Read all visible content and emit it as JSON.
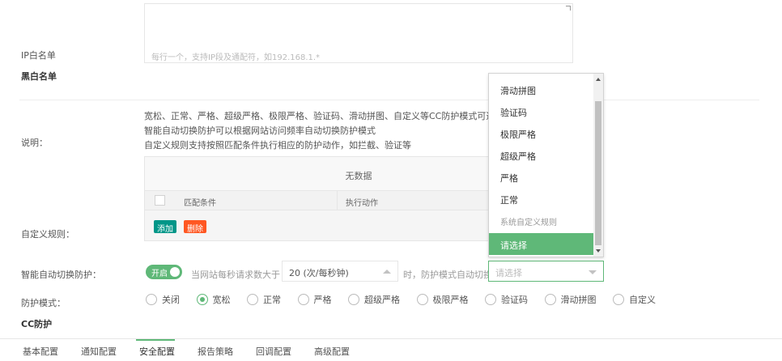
{
  "tabs": [
    {
      "label": "基本配置"
    },
    {
      "label": "通知配置"
    },
    {
      "label": "安全配置"
    },
    {
      "label": "报告策略"
    },
    {
      "label": "回调配置"
    },
    {
      "label": "高级配置"
    }
  ],
  "cc": {
    "title": "CC防护",
    "mode_label": "防护模式：",
    "modes": [
      {
        "label": "关闭",
        "checked": false
      },
      {
        "label": "宽松",
        "checked": true
      },
      {
        "label": "正常",
        "checked": false
      },
      {
        "label": "严格",
        "checked": false
      },
      {
        "label": "超级严格",
        "checked": false
      },
      {
        "label": "极限严格",
        "checked": false
      },
      {
        "label": "验证码",
        "checked": false
      },
      {
        "label": "滑动拼图",
        "checked": false
      },
      {
        "label": "自定义",
        "checked": false
      }
    ],
    "auto_label": "智能自动切换防护：",
    "switch_text": "开启",
    "auto_desc": "当网站每秒请求数大于",
    "qps_value": "20 (次/每秒钟)",
    "auto_desc2": "时，防护模式自动切换为",
    "auto_select_placeholder": "请选择",
    "custom_label": "自定义规则：",
    "table": {
      "title": "无数据",
      "col1": "匹配条件",
      "col2": "执行动作",
      "add_btn": "添加",
      "del_btn": "删除"
    },
    "desc_label": "说明：",
    "desc_lines": [
      "宽松、正常、严格、超级严格、极限严格、验证码、滑动拼图、自定义等CC防护模式可选",
      "智能自动切换防护可以根据网站访问频率自动切换防护模式",
      "自定义规则支持按照匹配条件执行相应的防护动作，如拦截、验证等"
    ]
  },
  "blacklist": {
    "title": "黑白名单",
    "ip_label": "IP白名单",
    "placeholder": "每行一个，支持IP段及通配符，如192.168.1.*"
  },
  "dropdown": {
    "items": [
      {
        "label": "滑动拼图",
        "kind": "option"
      },
      {
        "label": "验证码",
        "kind": "option"
      },
      {
        "label": "极限严格",
        "kind": "option"
      },
      {
        "label": "超级严格",
        "kind": "option"
      },
      {
        "label": "严格",
        "kind": "option"
      },
      {
        "label": "正常",
        "kind": "option"
      },
      {
        "label": "系统自定义规则",
        "kind": "group"
      },
      {
        "label": "请选择",
        "kind": "selected"
      }
    ]
  },
  "colors": {
    "accent": "#5fb878",
    "add_button": "#009688",
    "delete_button": "#ff5722"
  }
}
